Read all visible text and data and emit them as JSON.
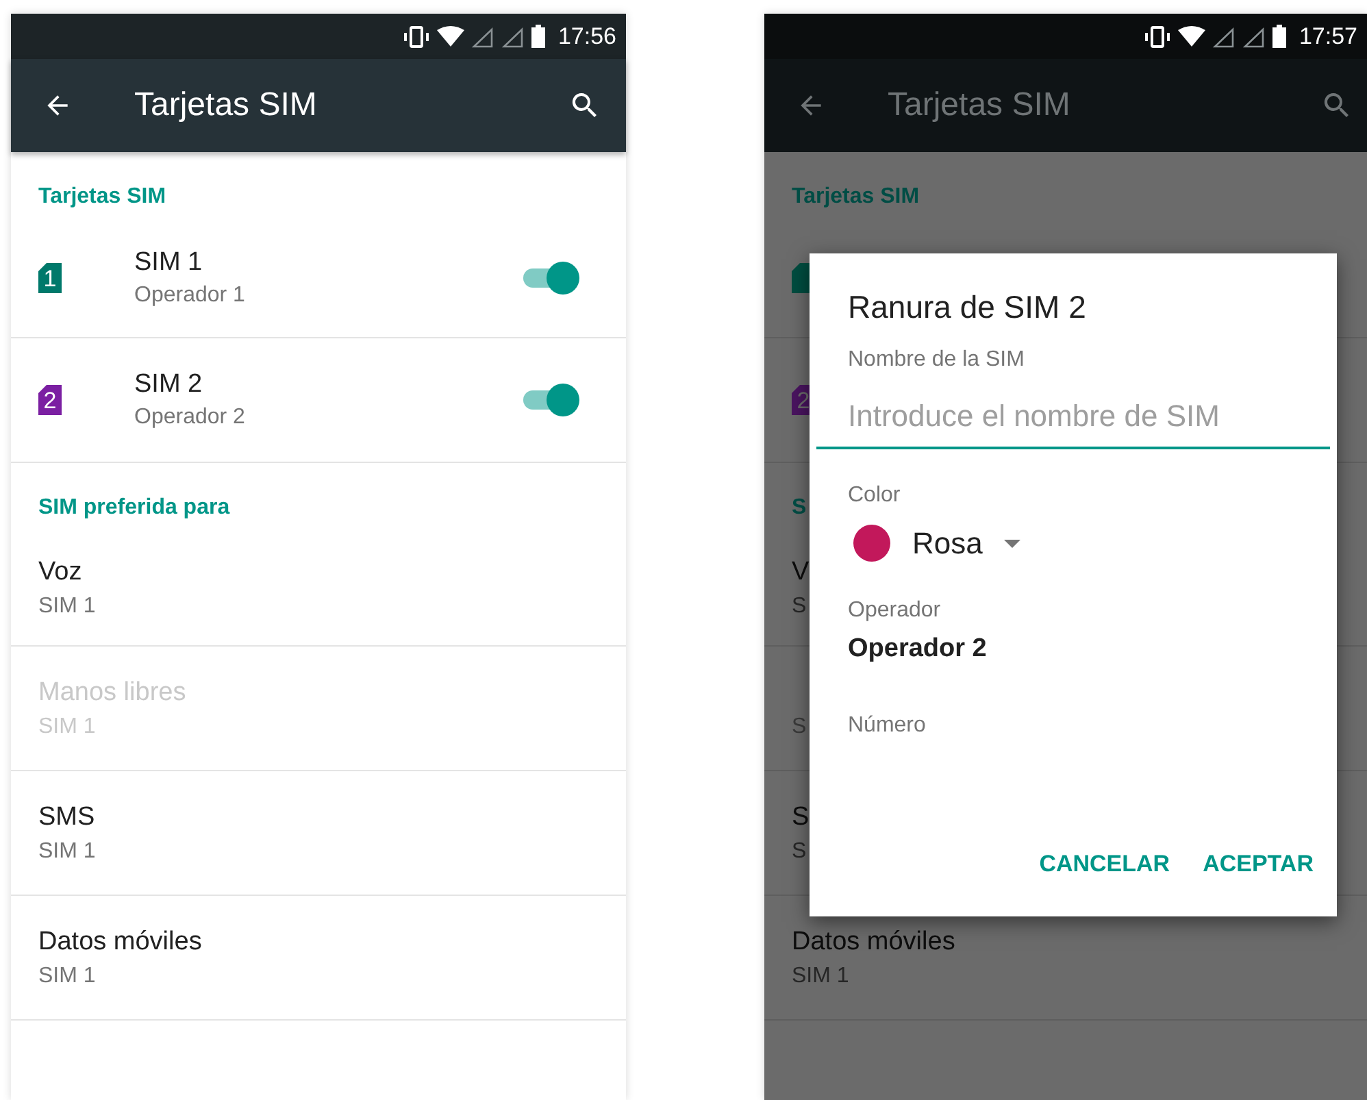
{
  "screens": [
    {
      "dimmed": false,
      "status_bar": {
        "time": "17:56"
      },
      "toolbar": {
        "title": "Tarjetas SIM"
      },
      "sections": [
        {
          "header": "Tarjetas SIM",
          "items": [
            {
              "kind": "sim",
              "icon_label": "1",
              "color": "#00796b",
              "title": "SIM 1",
              "subtitle": "Operador 1",
              "checked": true
            },
            {
              "kind": "sim",
              "icon_label": "2",
              "color": "#7b1fa2",
              "title": "SIM 2",
              "subtitle": "Operador 2",
              "checked": true
            }
          ]
        },
        {
          "header": "SIM preferida para",
          "items": [
            {
              "kind": "pref",
              "title": "Voz",
              "subtitle": "SIM 1",
              "disabled": false
            },
            {
              "kind": "pref",
              "title": "Manos libres",
              "subtitle": "SIM 1",
              "disabled": true
            },
            {
              "kind": "pref",
              "title": "SMS",
              "subtitle": "SIM 1",
              "disabled": false
            },
            {
              "kind": "pref",
              "title": "Datos móviles",
              "subtitle": "SIM 1",
              "disabled": false
            }
          ]
        }
      ]
    },
    {
      "dimmed": true,
      "status_bar": {
        "time": "17:57"
      },
      "toolbar": {
        "title": "Tarjetas SIM"
      },
      "sections": [
        {
          "header": "Tarjetas SIM",
          "items": [
            {
              "kind": "sim",
              "color": "#004d40"
            },
            {
              "kind": "sim",
              "icon_label": "2",
              "color": "#4a1460"
            }
          ]
        },
        {
          "header": "S",
          "items": [
            {
              "kind": "pref",
              "title": "V",
              "subtitle": "S",
              "disabled": false
            },
            {
              "kind": "pref",
              "subtitle": "S",
              "disabled": true
            },
            {
              "kind": "pref",
              "title": "S",
              "subtitle": "S",
              "disabled": false
            },
            {
              "kind": "pref",
              "title": "Datos móviles",
              "subtitle": "SIM 1",
              "disabled": false
            }
          ]
        }
      ],
      "dialog": {
        "title": "Ranura de SIM 2",
        "name_label": "Nombre de la SIM",
        "name_placeholder": "Introduce el nombre de SIM",
        "color_label": "Color",
        "color_value": "Rosa",
        "color": "#c2185b",
        "operator_label": "Operador",
        "operator_value": "Operador 2",
        "number_label": "Número",
        "buttons": [
          "CANCELAR",
          "ACEPTAR"
        ]
      }
    }
  ]
}
